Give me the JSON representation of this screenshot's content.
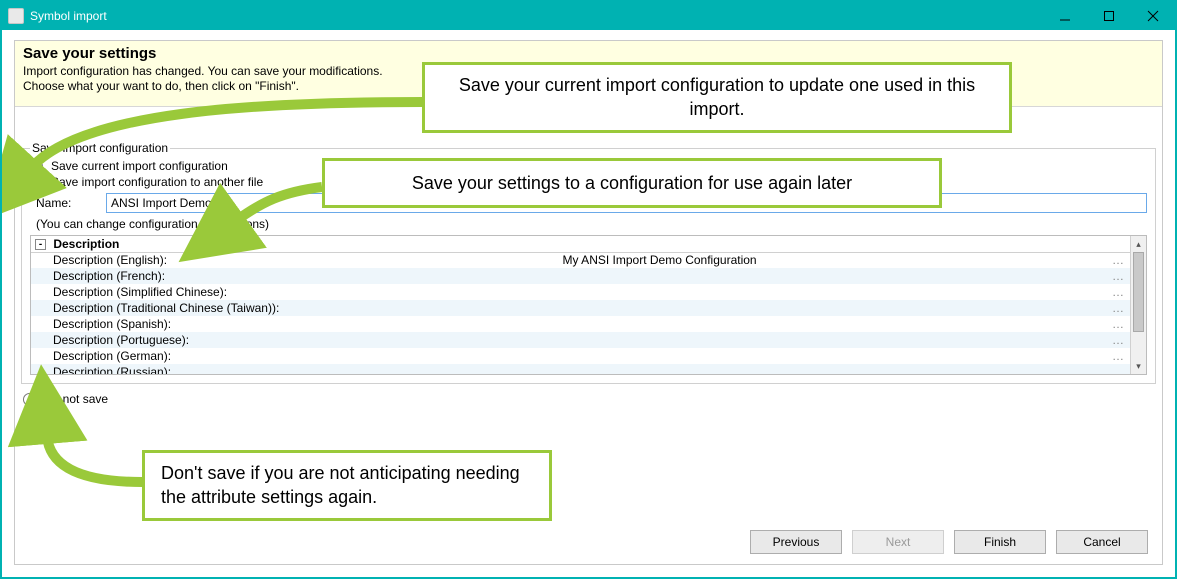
{
  "window": {
    "title": "Symbol import"
  },
  "banner": {
    "heading": "Save your settings",
    "line1": "Import configuration has changed. You can save your modifications.",
    "line2": "Choose what your want to do, then click on \"Finish\"."
  },
  "group": {
    "legend": "Save import configuration",
    "opt_save_current": "Save current import configuration",
    "opt_save_other": "Save import configuration to another file",
    "name_label": "Name:",
    "name_value": "ANSI Import Demo",
    "hint": "(You can change configuration descriptions)",
    "header_label": "Description",
    "value_english": "My ANSI Import Demo Configuration",
    "rows": [
      {
        "label": "Description (English):"
      },
      {
        "label": "Description (French):"
      },
      {
        "label": "Description (Simplified Chinese):"
      },
      {
        "label": "Description (Traditional Chinese (Taiwan)):"
      },
      {
        "label": "Description (Spanish):"
      },
      {
        "label": "Description (Portuguese):"
      },
      {
        "label": "Description (German):"
      },
      {
        "label": "Description (Russian):"
      }
    ],
    "opt_do_not_save": "Do not save"
  },
  "callouts": {
    "c1": "Save your current import configuration to update one used in this import.",
    "c2": "Save your settings to a configuration for use again later",
    "c3": "Don't save if you are not anticipating needing the attribute settings again."
  },
  "footer": {
    "previous": "Previous",
    "next": "Next",
    "finish": "Finish",
    "cancel": "Cancel"
  },
  "glyphs": {
    "dots": "…"
  }
}
